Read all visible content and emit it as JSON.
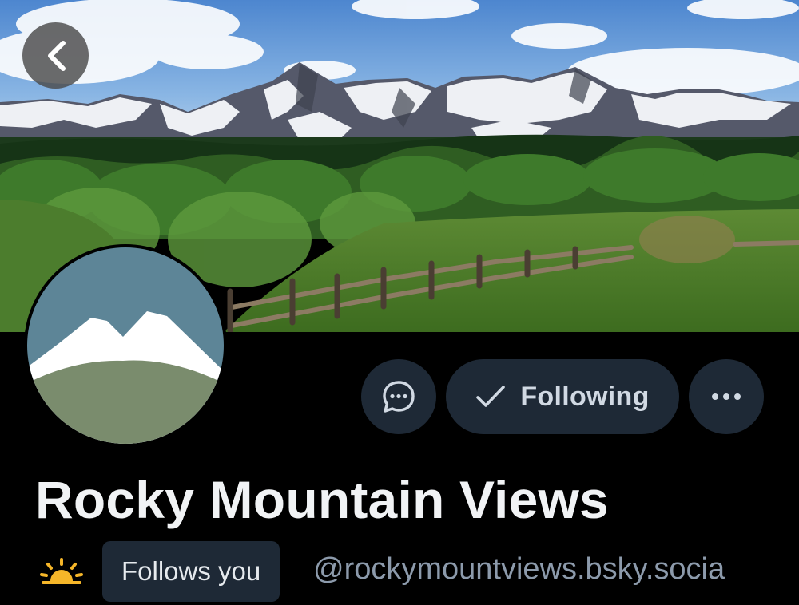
{
  "header": {
    "back_icon": "chevron-left-icon",
    "banner_image": "mountain-landscape-banner"
  },
  "profile": {
    "avatar_image": "rocky-mountain-logo",
    "display_name": "Rocky Mountain Views",
    "handle": "@rockymountviews.bsky.socia",
    "follows_you_label": "Follows you",
    "emoji": "sun-emoji"
  },
  "actions": {
    "message_icon": "chat-bubble-icon",
    "following_label": "Following",
    "following_icon": "checkmark-icon",
    "more_icon": "ellipsis-icon"
  },
  "colors": {
    "background": "#000000",
    "button_bg": "#1e2936",
    "handle_text": "#8c9aab",
    "avatar_sky": "#5d8597",
    "avatar_snow": "#ffffff",
    "avatar_ground": "#7a8c6d",
    "sun": "#f5b629"
  }
}
